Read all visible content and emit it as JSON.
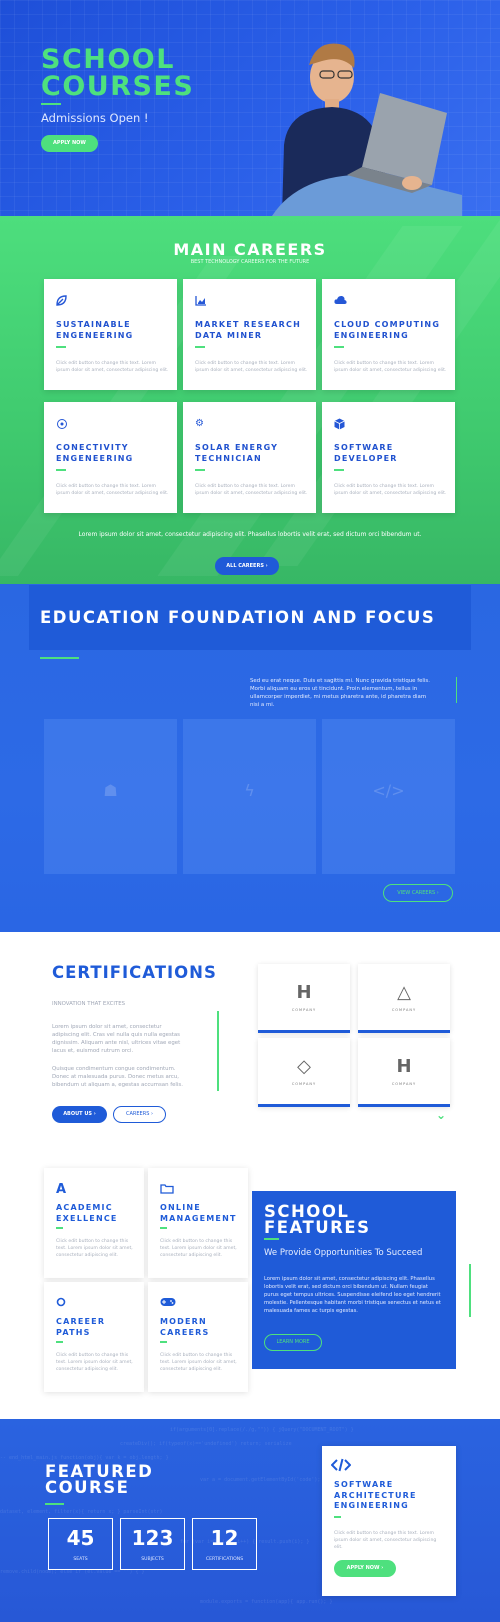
{
  "hero": {
    "title": "SCHOOL COURSES",
    "subtitle": "Admissions Open !",
    "cta": "APPLY NOW"
  },
  "careers": {
    "title": "MAIN CAREERS",
    "subtitle": "BEST TECHNOLOGY CAREERS FOR THE FUTURE",
    "cards": [
      {
        "icon": "leaf-icon",
        "title": "SUSTAINABLE ENGENEERING",
        "desc": "Click edit button to change this text. Lorem ipsum dolor sit amet, consectetur adipiscing elit."
      },
      {
        "icon": "chart-icon",
        "title": "MARKET RESEARCH DATA MINER",
        "desc": "Click edit button to change this text. Lorem ipsum dolor sit amet, consectetur adipiscing elit."
      },
      {
        "icon": "cloud-icon",
        "title": "CLOUD COMPUTING ENGINEERING",
        "desc": "Click edit button to change this text. Lorem ipsum dolor sit amet, consectetur adipiscing elit."
      },
      {
        "icon": "network-icon",
        "title": "CONECTIVITY ENGENEERING",
        "desc": "Click edit button to change this text. Lorem ipsum dolor sit amet, consectetur adipiscing elit."
      },
      {
        "icon": "gear-icon",
        "title": "SOLAR ENERGY TECHNICIAN",
        "desc": "Click edit button to change this text. Lorem ipsum dolor sit amet, consectetur adipiscing elit."
      },
      {
        "icon": "cube-icon",
        "title": "SOFTWARE DEVELOPER",
        "desc": "Click edit button to change this text. Lorem ipsum dolor sit amet, consectetur adipiscing elit."
      }
    ],
    "text": "Lorem ipsum dolor sit amet, consectetur adipiscing elit. Phasellus lobortis velit erat, sed dictum orci bibendum ut.",
    "button": "ALL CAREERS ›"
  },
  "education": {
    "title": "EDUCATION FOUNDATION AND FOCUS",
    "text": "Sed eu erat neque. Duis et sagittis mi. Nunc gravida tristique felis. Morbi aliquam eu eros ut tincidunt. Proin elementum, tellus in ullamcorper imperdiet, mi metus pharetra ante, id pharetra diam nisi a mi.",
    "button": "VIEW CAREERS ›"
  },
  "certifications": {
    "title": "CERTIFICATIONS",
    "subtitle": "INNOVATION THAT EXCITES",
    "p1": "Lorem ipsum dolor sit amet, consectetur adipiscing elit. Cras vel nulla quis nulla egestas dignissim. Aliquam ante nisl, ultrices vitae eget lacus et, euismod rutrum orci.",
    "p2": "Quisque condimentum congue condimentum. Donec at malesuada purus. Donec metus arcu, bibendum ut aliquam a, egestas accumsan felis.",
    "about_btn": "ABOUT US ›",
    "careers_btn": "CAREERS ›",
    "logo_caption": "COMPANY"
  },
  "features": {
    "cards": [
      {
        "icon": "A",
        "title": "ACADEMIC EXELLENCE",
        "desc": "Click edit button to change this text. Lorem ipsum dolor sit amet, consectetur adipiscing elit."
      },
      {
        "icon": "folder-icon",
        "title": "ONLINE MANAGEMENT",
        "desc": "Click edit button to change this text. Lorem ipsum dolor sit amet, consectetur adipiscing elit."
      },
      {
        "icon": "circle-icon",
        "title": "CAREEER PATHS",
        "desc": "Click edit button to change this text. Lorem ipsum dolor sit amet, consectetur adipiscing elit."
      },
      {
        "icon": "gamepad-icon",
        "title": "MODERN CAREERS",
        "desc": "Click edit button to change this text. Lorem ipsum dolor sit amet, consectetur adipiscing elit."
      }
    ],
    "title": "SCHOOL FEATURES",
    "subtitle": "We Provide Opportunities To Succeed",
    "text": "Lorem ipsum dolor sit amet, consectetur adipiscing elit. Phasellus lobortis velit erat, sed dictum orci bibendum ut. Nullam feugiat purus eget tempus ultrices. Suspendisse eleifend leo eget hendrerit molestie. Pellentesque habitant morbi tristique senectus et netus et malesuada fames ac turpis egestas.",
    "button": "LEARN MORE"
  },
  "featured": {
    "title": "FEATURED COURSE",
    "stats": [
      {
        "value": "45",
        "label": "SEATS"
      },
      {
        "value": "123",
        "label": "SUBJECTS"
      },
      {
        "value": "12",
        "label": "CERTIFICATIONS"
      }
    ],
    "card": {
      "icon": "code-icon",
      "title": "SOFTWARE ARCHITECTURE ENGINEERING",
      "desc": "Click edit button to change this text. Lorem ipsum dolor sit amet, consectetur adipiscing elit.",
      "button": "APPLY NOW ›"
    }
  },
  "colors": {
    "primary": "#1f5bd8",
    "accent": "#4ee07e"
  }
}
